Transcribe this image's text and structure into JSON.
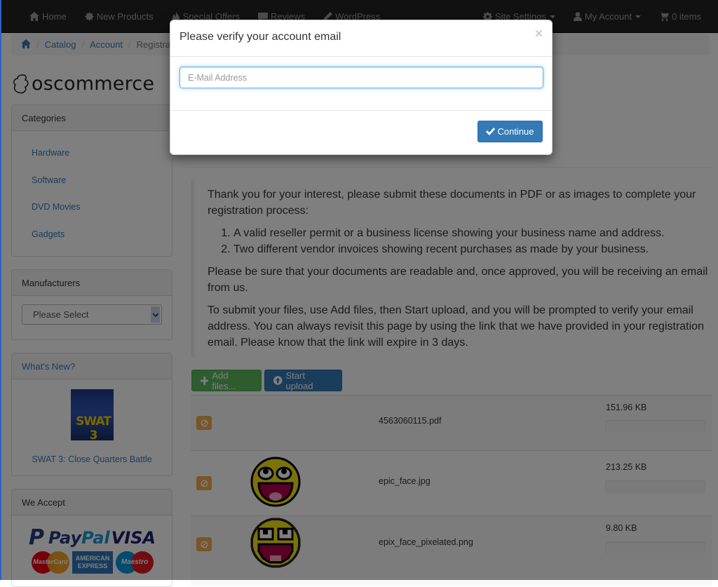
{
  "navbar": {
    "left": [
      {
        "label": "Home",
        "icon": "home-icon"
      },
      {
        "label": "New Products",
        "icon": "certificate-icon"
      },
      {
        "label": "Special Offers",
        "icon": "fire-icon"
      },
      {
        "label": "Reviews",
        "icon": "comment-icon"
      },
      {
        "label": "WordPress",
        "icon": "pencil-icon"
      }
    ],
    "right": [
      {
        "label": "Site Settings",
        "icon": "cog-icon",
        "dropdown": true
      },
      {
        "label": "My Account",
        "icon": "user-icon",
        "dropdown": true
      },
      {
        "label": "0 items",
        "icon": "shopping-cart-icon"
      }
    ]
  },
  "breadcrumb": {
    "items": [
      "Catalog",
      "Account",
      "Registration"
    ],
    "home_icon": "home-icon"
  },
  "logo": {
    "text": "oscommerce"
  },
  "sidebar": {
    "categories": {
      "title": "Categories",
      "items": [
        "Hardware",
        "Software",
        "DVD Movies",
        "Gadgets"
      ]
    },
    "manufacturers": {
      "title": "Manufacturers",
      "select_value": "Please Select"
    },
    "whats_new": {
      "title": "What's New?",
      "product_name": "SWAT 3: Close Quarters Battle",
      "product_image_text": "SWAT 3"
    },
    "we_accept": {
      "title": "We Accept",
      "logos": [
        "PayPal",
        "VISA",
        "MasterCard",
        "American Express",
        "Maestro"
      ]
    }
  },
  "main": {
    "intro": "Thank you for your interest, please submit these documents in PDF or as images to complete your registration process:",
    "requirements": [
      "A valid reseller permit or a business license showing your business name and address.",
      "Two different vendor invoices showing recent purchases as made by your business."
    ],
    "note": "Please be sure that your documents are readable and, once approved, you will be receiving an email from us.",
    "instructions": "To submit your files, use Add files, then Start upload, and you will be prompted to verify your email address. You can always revisit this page by using the link that we have provided in your registration email. Please know that the link will expire in 3 days.",
    "add_files_label": "Add files...",
    "start_upload_label": "Start upload",
    "files": [
      {
        "name": "4563060115.pdf",
        "size": "151.96 KB",
        "progress_percent": 0,
        "has_thumb": false
      },
      {
        "name": "epic_face.jpg",
        "size": "213.25 KB",
        "progress_percent": 0,
        "has_thumb": true
      },
      {
        "name": "epix_face_pixelated.png",
        "size": "9.80 KB",
        "progress_percent": 0,
        "has_thumb": true
      }
    ]
  },
  "modal": {
    "title": "Please verify your account email",
    "close_label": "×",
    "email_placeholder": "E-Mail Address",
    "email_value": "",
    "continue_label": "Continue"
  },
  "colors": {
    "primary": "#337ab7",
    "success": "#5cb85c",
    "warning": "#f0ad4e",
    "navbar": "#222222"
  }
}
